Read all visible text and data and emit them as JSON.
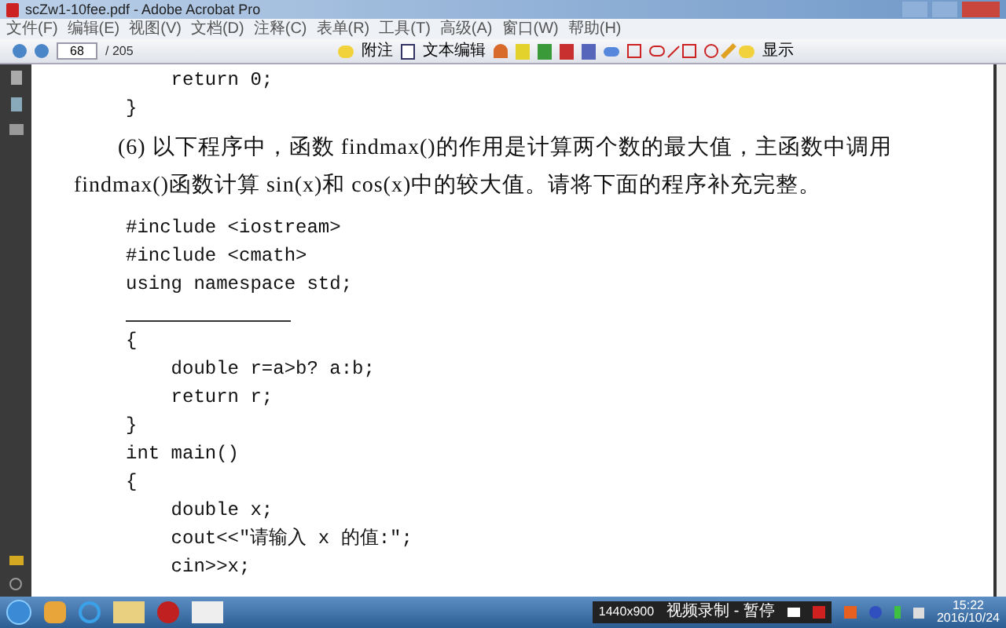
{
  "window": {
    "title": "scZw1-10fee.pdf - Adobe Acrobat Pro"
  },
  "menu": [
    "文件(F)",
    "编辑(E)",
    "视图(V)",
    "文档(D)",
    "注释(C)",
    "表单(R)",
    "工具(T)",
    "高级(A)",
    "窗口(W)",
    "帮助(H)"
  ],
  "toolbar": {
    "page": "68",
    "page_total": "/ 205",
    "note": "附注",
    "text_edit": "文本编辑",
    "show": "显示"
  },
  "document": [
    {
      "kind": "code",
      "text": "    return 0;"
    },
    {
      "kind": "code",
      "text": "}"
    },
    {
      "kind": "paragraph",
      "text": "(6) 以下程序中，函数 findmax()的作用是计算两个数的最大值，主函数中调用 findmax()函数计算 sin(x)和 cos(x)中的较大值。请将下面的程序补充完整。"
    },
    {
      "kind": "code",
      "text": "#include <iostream>"
    },
    {
      "kind": "code",
      "text": "#include <cmath>"
    },
    {
      "kind": "code",
      "text": "using namespace std;"
    },
    {
      "kind": "blank"
    },
    {
      "kind": "code",
      "text": "{"
    },
    {
      "kind": "code",
      "text": "    double r=a>b? a:b;"
    },
    {
      "kind": "code",
      "text": "    return r;"
    },
    {
      "kind": "code",
      "text": "}"
    },
    {
      "kind": "code",
      "text": "int main()"
    },
    {
      "kind": "code",
      "text": "{"
    },
    {
      "kind": "code",
      "text": "    double x;"
    },
    {
      "kind": "code",
      "text": "    cout<<\"请输入 x 的值:\";"
    },
    {
      "kind": "code",
      "text": "    cin>>x;"
    }
  ],
  "taskbar": {
    "window_label": "1440x900",
    "recorder": "视频录制 - 暂停",
    "time": "15:22",
    "date": "2016/10/24"
  }
}
